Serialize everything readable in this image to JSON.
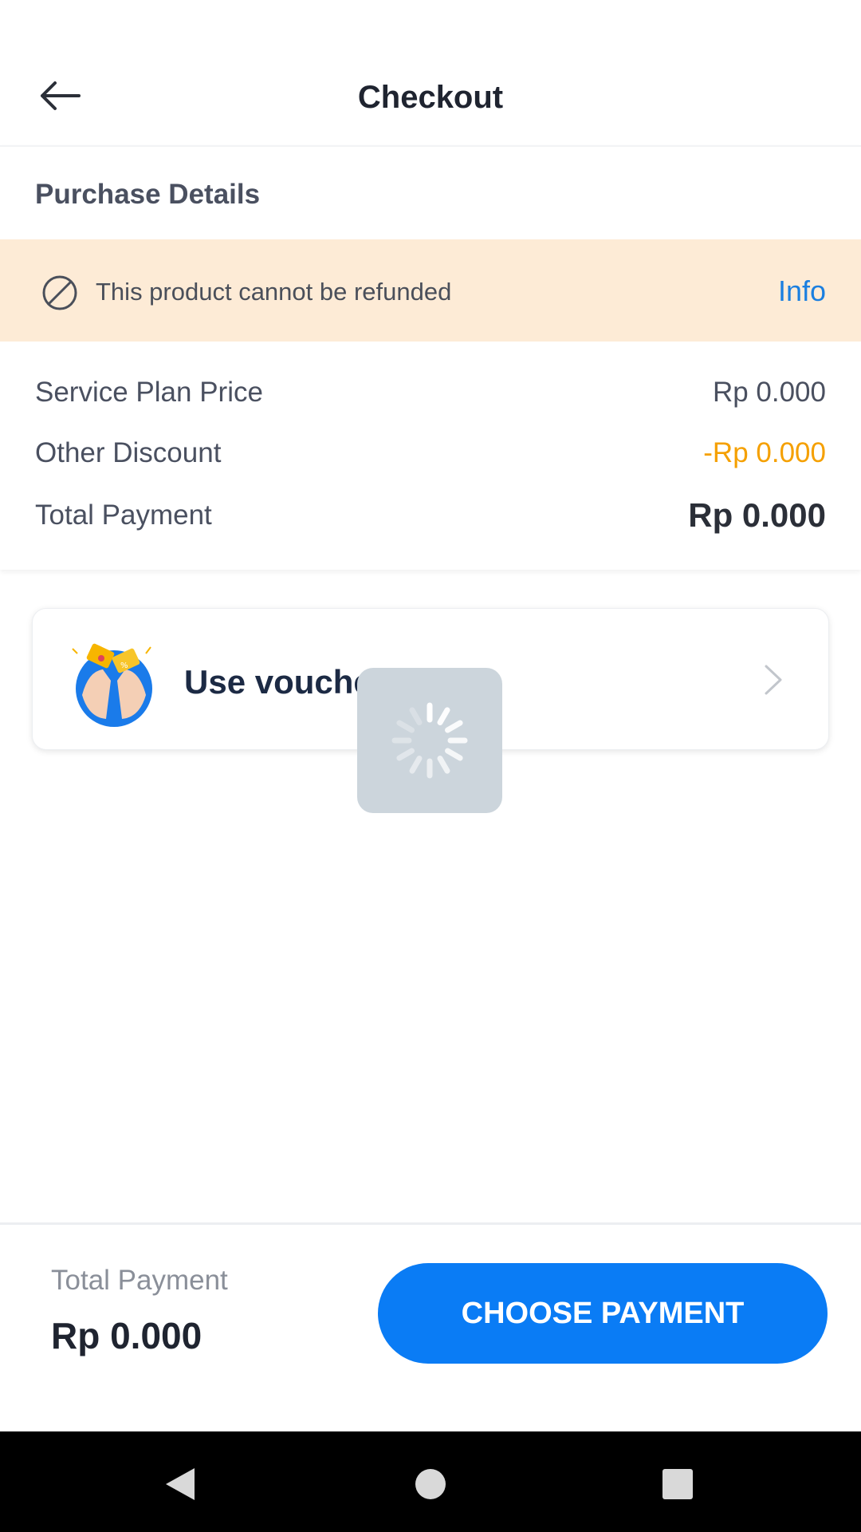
{
  "header": {
    "title": "Checkout",
    "back_icon": "arrow-left-icon"
  },
  "purchase_details": {
    "section_title": "Purchase Details",
    "refund_notice": {
      "icon": "ban-icon",
      "text": "This product cannot be refunded",
      "link_label": "Info"
    },
    "rows": [
      {
        "label": "Service Plan Price",
        "value": "Rp 0.000"
      },
      {
        "label": "Other Discount",
        "value": "-Rp 0.000"
      },
      {
        "label": "Total Payment",
        "value": "Rp 0.000"
      }
    ]
  },
  "voucher": {
    "label": "Use vouche",
    "icon": "voucher-hands-icon",
    "chevron": "chevron-right-icon"
  },
  "loading": {
    "icon": "spinner-icon"
  },
  "footer": {
    "total_label": "Total Payment",
    "total_value": "Rp 0.000",
    "button_label": "CHOOSE PAYMENT"
  },
  "system_nav": {
    "back": "nav-back-icon",
    "home": "nav-home-icon",
    "recents": "nav-recents-icon"
  },
  "colors": {
    "accent": "#0a7cf5",
    "discount": "#f5a000",
    "banner_bg": "#fdebd6",
    "link": "#1b7fe0"
  }
}
